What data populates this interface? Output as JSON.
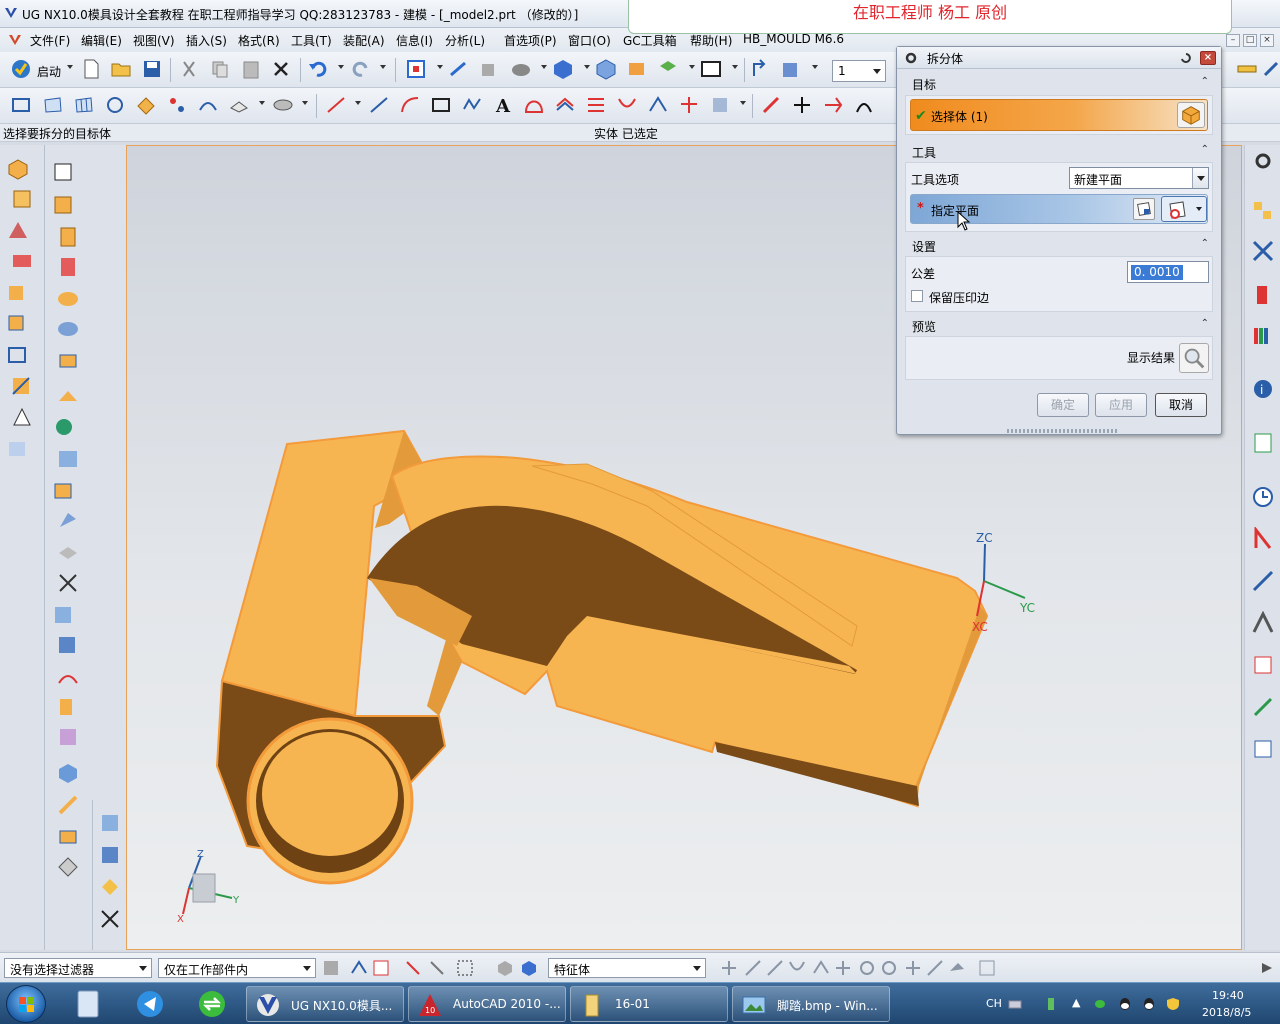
{
  "window": {
    "title": "UG NX10.0模具设计全套教程 在职工程师指导学习 QQ:283123783 - 建模 - [_model2.prt （修改的）]",
    "watermark": "在职工程师 杨工 原创",
    "controls": [
      "–",
      "□",
      "×"
    ]
  },
  "menubar": {
    "items": [
      {
        "label": "文件(F)"
      },
      {
        "label": "编辑(E)"
      },
      {
        "label": "视图(V)"
      },
      {
        "label": "插入(S)"
      },
      {
        "label": "格式(R)"
      },
      {
        "label": "工具(T)"
      },
      {
        "label": "装配(A)"
      },
      {
        "label": "信息(I)"
      },
      {
        "label": "分析(L)"
      },
      {
        "label": "首选项(P)"
      },
      {
        "label": "窗口(O)"
      },
      {
        "label": "GC工具箱"
      },
      {
        "label": "帮助(H)"
      },
      {
        "label": "HB_MOULD M6.6"
      }
    ]
  },
  "toolbar": {
    "start_label": "启动",
    "layer_value": "1"
  },
  "cue": {
    "prompt": "选择要拆分的目标体",
    "status": "实体 已选定"
  },
  "dialog": {
    "title": "拆分体",
    "target_group": "目标",
    "select_body": "选择体 (1)",
    "tool_group": "工具",
    "tool_option_label": "工具选项",
    "tool_option_value": "新建平面",
    "specify_plane": "指定平面",
    "settings_group": "设置",
    "tolerance_label": "公差",
    "tolerance_value": "0. 0010",
    "keep_imprint": "保留压印边",
    "preview_group": "预览",
    "show_result": "显示结果",
    "ok": "确定",
    "apply": "应用",
    "cancel": "取消"
  },
  "triad": {
    "zc": "ZC",
    "yc": "YC",
    "xc": "XC",
    "z": "Z",
    "y": "Y",
    "x": "X"
  },
  "statusbar": {
    "filter": "没有选择过滤器",
    "scope": "仅在工作部件内",
    "type": "特征体"
  },
  "taskbar": {
    "items": [
      {
        "label": "UG NX10.0模具..."
      },
      {
        "label": "AutoCAD 2010 -..."
      },
      {
        "label": "16-01"
      },
      {
        "label": "脚踏.bmp - Win..."
      }
    ],
    "ime": "CH",
    "time": "19:40",
    "date": "2018/8/5"
  },
  "colors": {
    "part_face": "#f5b04c",
    "part_dark": "#7a4a17",
    "highlight": "#f08b1e",
    "watermark_text": "#e0262c"
  }
}
